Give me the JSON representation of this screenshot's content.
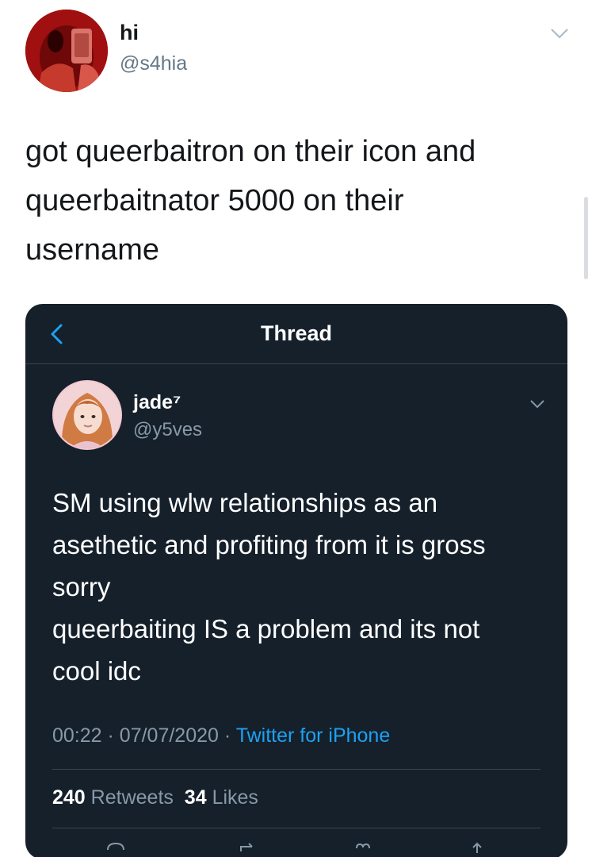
{
  "outer_tweet": {
    "display_name": "hi",
    "handle": "@s4hia",
    "text": "got queerbaitron on their icon and\nqueerbaitnator 5000 on their\nusername",
    "avatar_icon": "profile-photo",
    "menu_icon": "chevron-down-icon"
  },
  "quoted_screenshot": {
    "header": {
      "back_icon": "back-arrow-icon",
      "title": "Thread"
    },
    "tweet": {
      "display_name": "jade⁷",
      "handle": "@y5ves",
      "text": "SM using wlw relationships as an\nasethetic and profiting from it is gross\nsorry\nqueerbaiting IS a problem and its not\ncool idc",
      "time": "00:22",
      "date": "07/07/2020",
      "separator": "·",
      "source": "Twitter for iPhone",
      "retweets_count": "240",
      "retweets_label": "Retweets",
      "likes_count": "34",
      "likes_label": "Likes"
    },
    "actions": [
      "reply-icon",
      "retweet-icon",
      "like-icon",
      "share-icon"
    ]
  },
  "colors": {
    "card_background": "#15202b",
    "link_blue": "#1da1f2",
    "secondary_text": "#8899a6"
  }
}
